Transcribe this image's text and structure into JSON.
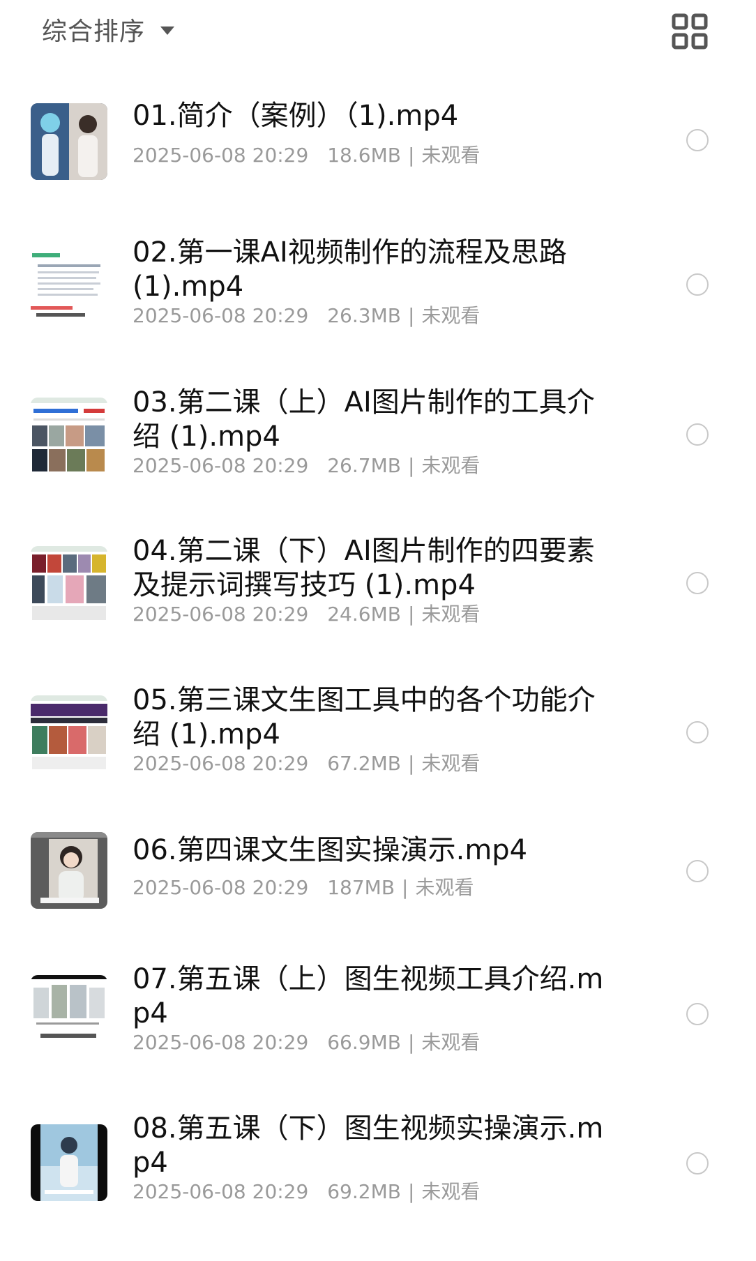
{
  "header": {
    "sort_label": "综合排序",
    "sort_caret_icon": "caret-down-icon",
    "view_toggle_icon": "grid-view-icon"
  },
  "colors": {
    "text_primary": "#111111",
    "text_secondary": "#9a9a9a",
    "radio_border": "#c8c8c8",
    "icon": "#555555"
  },
  "files": [
    {
      "title": "01.简介（案例）（1).mp4",
      "date": "2025-06-08 20:29",
      "size": "18.6MB",
      "status": "未观看"
    },
    {
      "title": "02.第一课AI视频制作的流程及思路 (1).mp4",
      "date": "2025-06-08 20:29",
      "size": "26.3MB",
      "status": "未观看"
    },
    {
      "title": "03.第二课（上）AI图片制作的工具介绍 (1).mp4",
      "date": "2025-06-08 20:29",
      "size": "26.7MB",
      "status": "未观看"
    },
    {
      "title": "04.第二课（下）AI图片制作的四要素及提示词撰写技巧 (1).mp4",
      "date": "2025-06-08 20:29",
      "size": "24.6MB",
      "status": "未观看"
    },
    {
      "title": "05.第三课文生图工具中的各个功能介绍 (1).mp4",
      "date": "2025-06-08 20:29",
      "size": "67.2MB",
      "status": "未观看"
    },
    {
      "title": "06.第四课文生图实操演示.mp4",
      "date": "2025-06-08 20:29",
      "size": "187MB",
      "status": "未观看"
    },
    {
      "title": "07.第五课（上）图生视频工具介绍.mp4",
      "date": "2025-06-08 20:29",
      "size": "66.9MB",
      "status": "未观看"
    },
    {
      "title": "08.第五课（下）图生视频实操演示.mp4",
      "date": "2025-06-08 20:29",
      "size": "69.2MB",
      "status": "未观看"
    }
  ]
}
